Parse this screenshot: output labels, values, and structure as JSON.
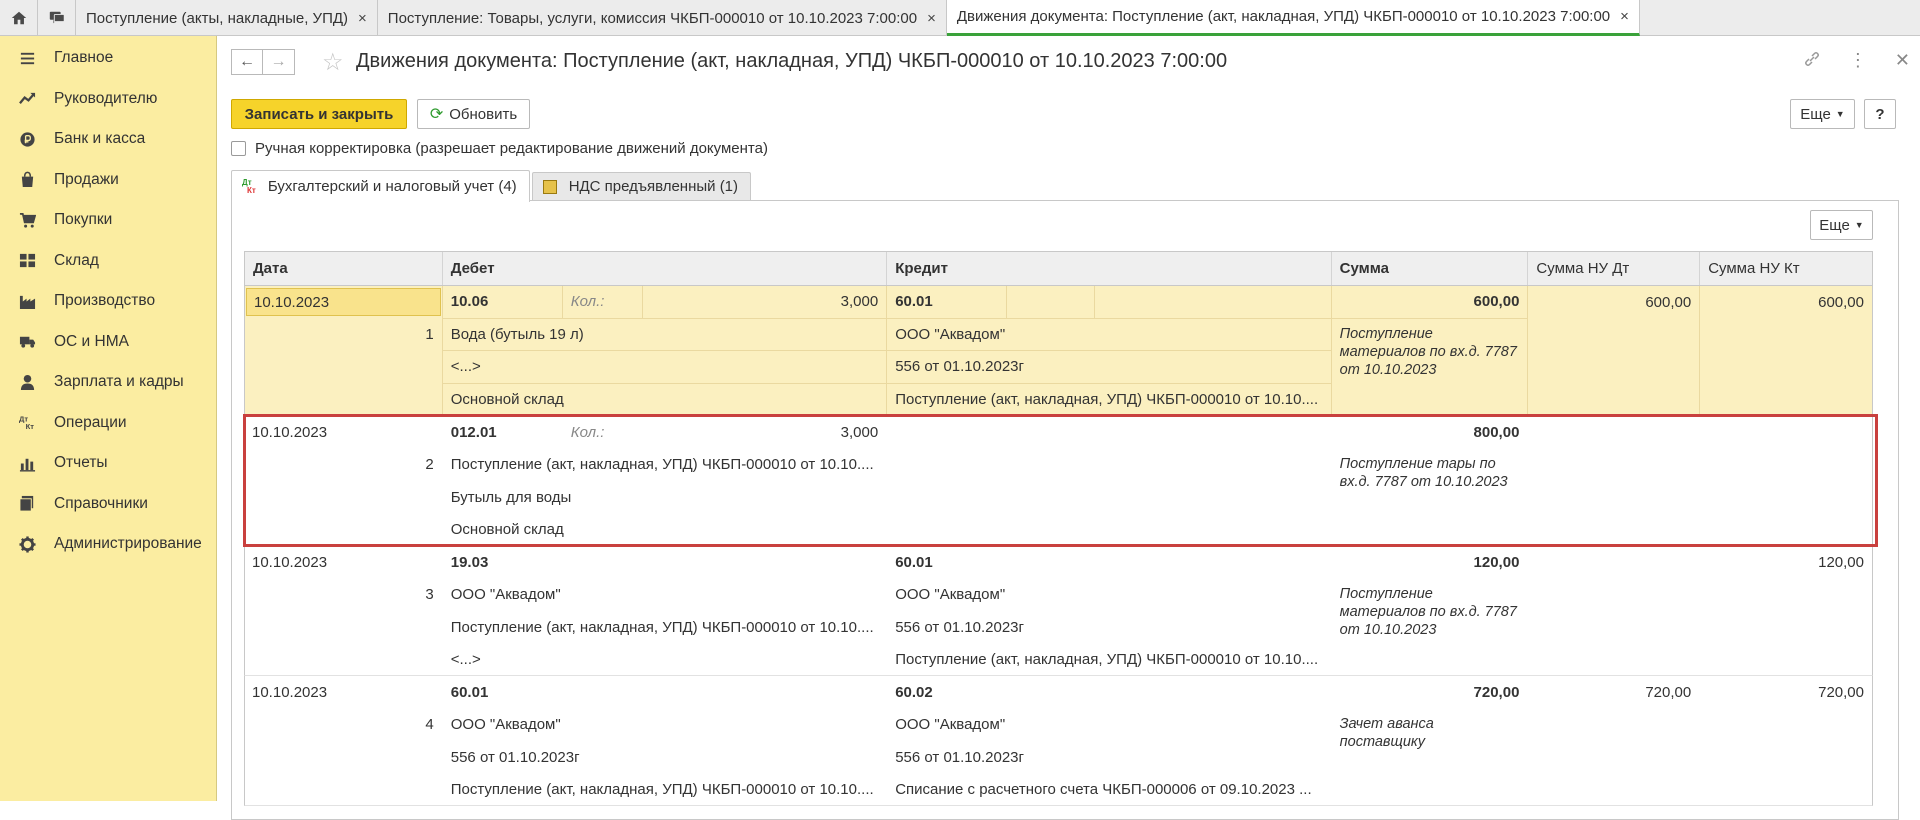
{
  "tabs": [
    {
      "label": "Поступление (акты, накладные, УПД)",
      "active": false
    },
    {
      "label": "Поступление: Товары, услуги, комиссия ЧКБП-000010 от 10.10.2023 7:00:00",
      "active": false
    },
    {
      "label": "Движения документа: Поступление (акт, накладная, УПД) ЧКБП-000010 от 10.10.2023 7:00:00",
      "active": true
    }
  ],
  "tab_close_glyph": "×",
  "sidebar": {
    "items": [
      {
        "label": "Главное",
        "icon": "menu-lines-icon"
      },
      {
        "label": "Руководителю",
        "icon": "trend-icon"
      },
      {
        "label": "Банк и касса",
        "icon": "coin-icon"
      },
      {
        "label": "Продажи",
        "icon": "bag-icon"
      },
      {
        "label": "Покупки",
        "icon": "cart-icon"
      },
      {
        "label": "Склад",
        "icon": "warehouse-icon"
      },
      {
        "label": "Производство",
        "icon": "factory-icon"
      },
      {
        "label": "ОС и НМА",
        "icon": "truck-icon"
      },
      {
        "label": "Зарплата и кадры",
        "icon": "person-icon"
      },
      {
        "label": "Операции",
        "icon": "dt-kt-icon"
      },
      {
        "label": "Отчеты",
        "icon": "bar-chart-icon"
      },
      {
        "label": "Справочники",
        "icon": "books-icon"
      },
      {
        "label": "Администрирование",
        "icon": "gear-icon"
      }
    ]
  },
  "header": {
    "title": "Движения документа: Поступление (акт, накладная, УПД) ЧКБП-000010 от 10.10.2023 7:00:00"
  },
  "toolbar": {
    "save_close": "Записать и закрыть",
    "refresh": "Обновить",
    "more": "Еще",
    "help": "?"
  },
  "manual_edit": {
    "label": "Ручная корректировка (разрешает редактирование движений документа)",
    "checked": false
  },
  "subtabs": [
    {
      "label": "Бухгалтерский и налоговый учет (4)",
      "icon_top": "Дт",
      "icon_bottom": "Кт"
    },
    {
      "label": "НДС предъявленный (1)"
    }
  ],
  "panel": {
    "more": "Еще"
  },
  "columns": [
    "Дата",
    "Дебет",
    "Кредит",
    "Сумма",
    "Сумма НУ Дт",
    "Сумма НУ Кт"
  ],
  "kol_label": "Кол.:",
  "records": [
    {
      "date": "10.10.2023",
      "n": "1",
      "selected": true,
      "debit": {
        "account": "10.06",
        "qty": "3,000",
        "lines": [
          "Вода (бутыль 19 л)",
          "<...>",
          "Основной склад"
        ]
      },
      "credit": {
        "account": "60.01",
        "qty": "",
        "lines": [
          "ООО \"Аквадом\"",
          "556 от 01.10.2023г",
          "Поступление (акт, накладная, УПД) ЧКБП-000010 от 10.10...."
        ]
      },
      "amount": "600,00",
      "comment": "Поступление материалов по вх.д. 7787 от 10.10.2023",
      "nu_dt": "600,00",
      "nu_kt": "600,00"
    },
    {
      "date": "10.10.2023",
      "n": "2",
      "selected": false,
      "debit": {
        "account": "012.01",
        "qty": "3,000",
        "lines": [
          "Поступление (акт, накладная, УПД) ЧКБП-000010 от 10.10....",
          "Бутыль для воды",
          "Основной склад"
        ]
      },
      "credit": {
        "account": "",
        "qty": "",
        "lines": [
          "",
          "",
          ""
        ]
      },
      "amount": "800,00",
      "comment": "Поступление тары по вх.д. 7787 от 10.10.2023",
      "nu_dt": "",
      "nu_kt": ""
    },
    {
      "date": "10.10.2023",
      "n": "3",
      "selected": false,
      "debit": {
        "account": "19.03",
        "qty": "",
        "lines": [
          "ООО \"Аквадом\"",
          "Поступление (акт, накладная, УПД) ЧКБП-000010 от 10.10....",
          "<...>"
        ]
      },
      "credit": {
        "account": "60.01",
        "qty": "",
        "lines": [
          "ООО \"Аквадом\"",
          "556 от 01.10.2023г",
          "Поступление (акт, накладная, УПД) ЧКБП-000010 от 10.10...."
        ]
      },
      "amount": "120,00",
      "comment": "Поступление материалов по вх.д. 7787 от 10.10.2023",
      "nu_dt": "",
      "nu_kt": "120,00"
    },
    {
      "date": "10.10.2023",
      "n": "4",
      "selected": false,
      "debit": {
        "account": "60.01",
        "qty": "",
        "lines": [
          "ООО \"Аквадом\"",
          "556 от 01.10.2023г",
          "Поступление (акт, накладная, УПД) ЧКБП-000010 от 10.10...."
        ]
      },
      "credit": {
        "account": "60.02",
        "qty": "",
        "lines": [
          "ООО \"Аквадом\"",
          "556 от 01.10.2023г",
          "Списание с расчетного счета ЧКБП-000006 от 09.10.2023 ..."
        ]
      },
      "amount": "720,00",
      "comment": "Зачет аванса поставщику",
      "nu_dt": "720,00",
      "nu_kt": "720,00"
    }
  ],
  "colors": {
    "sidebar_bg": "#fbeda1",
    "primary_button": "#f6d32a",
    "highlight_frame": "#c9403e",
    "active_tab_line": "#3aa23a",
    "selected_row": "#fbf0c0"
  }
}
